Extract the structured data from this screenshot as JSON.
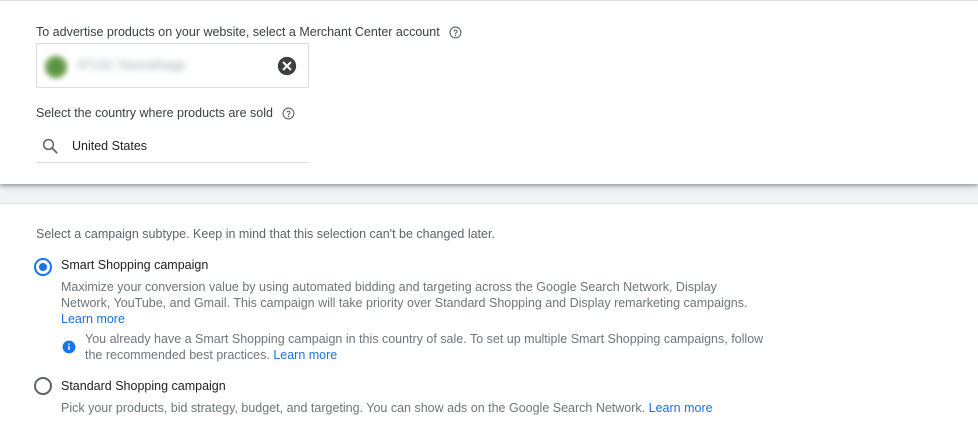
{
  "merchant": {
    "label": "To advertise products on your website, select a Merchant Center account",
    "account_name_blurred": "47131 Yasroshoga",
    "help_icon": "help-circle-icon",
    "clear_icon": "close-circle-icon"
  },
  "country": {
    "label": "Select the country where products are sold",
    "value": "United States",
    "search_icon": "search-icon"
  },
  "subtype": {
    "intro": "Select a campaign subtype. Keep in mind that this selection can't be changed later.",
    "smart": {
      "title": "Smart Shopping campaign",
      "desc_line1": "Maximize your conversion value by using automated bidding and targeting across the Google Search Network, Display",
      "desc_line2": "Network, YouTube, and Gmail. This campaign will take priority over Standard Shopping and Display remarketing campaigns.",
      "learn_more": "Learn more",
      "selected": true,
      "info_line1": "You already have a Smart Shopping campaign in this country of sale. To set up multiple Smart Shopping campaigns, follow",
      "info_line2": "the recommended best practices.",
      "info_learn_more": "Learn more"
    },
    "standard": {
      "title": "Standard Shopping campaign",
      "desc": "Pick your products, bid strategy, budget, and targeting. You can show ads on the Google Search Network.",
      "learn_more": "Learn more",
      "selected": false
    }
  },
  "colors": {
    "accent": "#1a73e8",
    "text_primary": "#202124",
    "text_secondary": "#70757a"
  }
}
